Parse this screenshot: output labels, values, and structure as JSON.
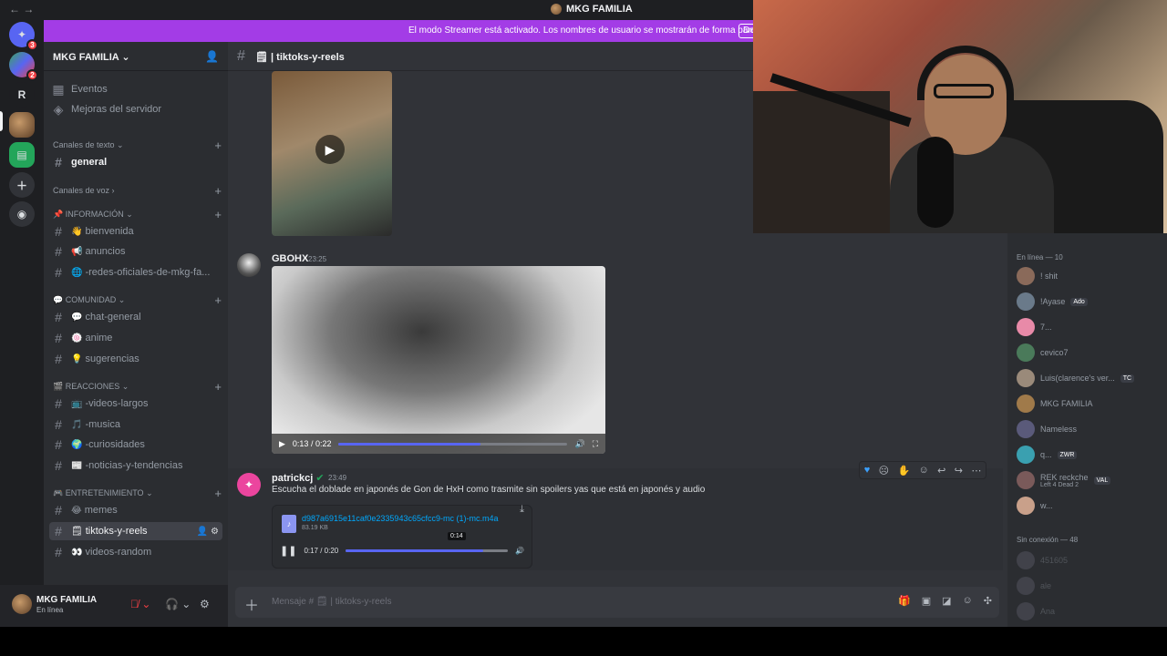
{
  "titlebar": {
    "back": "←",
    "forward": "→",
    "title": "MKG FAMILIA"
  },
  "streamer": {
    "message": "El modo Streamer está activado. Los nombres de usuario se mostrarán de forma parcial.",
    "button": "De"
  },
  "rail": {
    "badge1": "3",
    "badge2": "2",
    "server_r": "R"
  },
  "server": {
    "name": "MKG FAMILIA"
  },
  "sidebar": {
    "events": "Eventos",
    "boosts": "Mejoras del servidor",
    "cat_text": "Canales de texto",
    "general": "general",
    "cat_voice": "Canales de voz",
    "cat_info": "INFORMACIÓN",
    "bienvenida": "bienvenida",
    "anuncios": "anuncios",
    "redes": "-redes-oficiales-de-mkg-fa...",
    "cat_comunidad": "COMUNIDAD",
    "chat_general": "chat-general",
    "anime": "anime",
    "sugerencias": "sugerencias",
    "cat_reacciones": "REACCIONES",
    "videos_largos": "-videos-largos",
    "musica": "-musica",
    "curiosidades": "-curiosidades",
    "noticias": "-noticias-y-tendencias",
    "cat_entretenimiento": "ENTRETENIMIENTO",
    "memes": "memes",
    "tiktoks": "tiktoks-y-reels",
    "videos_random": "videos-random"
  },
  "user": {
    "name": "MKG FAMILIA",
    "status": "En línea"
  },
  "chat": {
    "channel": "tiktoks-y-reels",
    "msg2": {
      "author": "GBOHX",
      "time": "23:25",
      "video_time": "0:13 / 0:22",
      "progress": 0.62
    },
    "msg3": {
      "author": "patrickcj",
      "time": "23:49",
      "text": "Escucha el doblade en japonés de Gon de HxH como trasmite sin spoilers yas que está en japonés y audio",
      "file": "d987a6915e11caf0e2335943c65cfcc9-mc (1)-mc.m4a",
      "size": "83.19 KB",
      "tooltip": "0:14",
      "audio_time": "0:17 / 0:20",
      "progress": 0.85
    },
    "input_placeholder": "Mensaje # 🗒 | tiktoks-y-reels"
  },
  "members": {
    "online_header": "En línea — 10",
    "offline_header": "Sin conexión — 48",
    "online": [
      {
        "name": "! shit",
        "tag": ""
      },
      {
        "name": "!Ayase",
        "tag": "Ado"
      },
      {
        "name": "7...",
        "tag": ""
      },
      {
        "name": "cevico7",
        "tag": ""
      },
      {
        "name": "Luis(clarence's ver...",
        "tag": "TC"
      },
      {
        "name": "MKG FAMILIA",
        "tag": ""
      },
      {
        "name": "Nameless",
        "tag": ""
      },
      {
        "name": "q...",
        "tag": "ZWR"
      },
      {
        "name": "REK reckche",
        "tag": "VAL",
        "sub": "Left 4 Dead 2"
      },
      {
        "name": "w...",
        "tag": ""
      }
    ],
    "offline": [
      {
        "name": "451605"
      },
      {
        "name": "ale"
      },
      {
        "name": "Ana"
      }
    ]
  },
  "colors": {
    "accent": "#5865f2",
    "streamer": "#a33ce6",
    "link": "#00a8fc"
  }
}
